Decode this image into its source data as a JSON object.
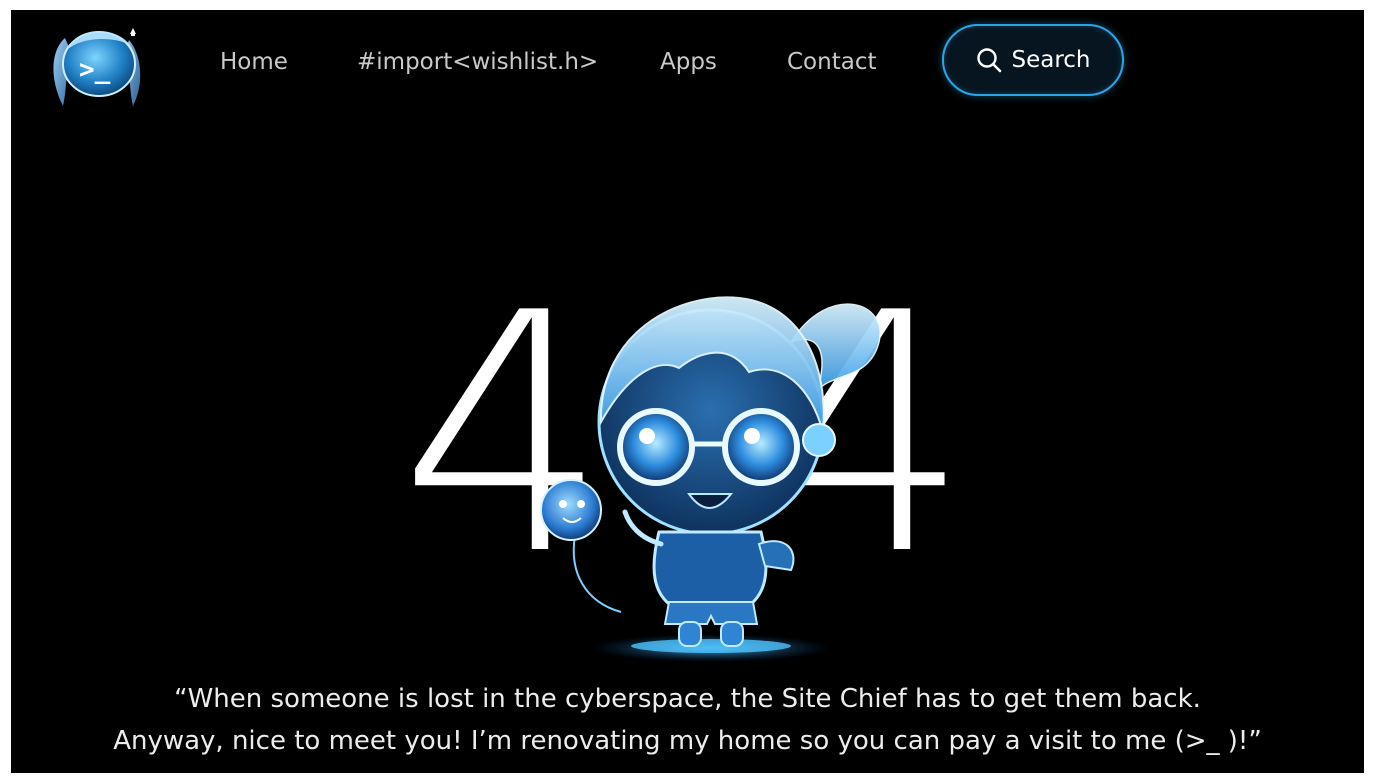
{
  "nav": {
    "logo_alt": "site logo",
    "links": [
      {
        "label": "Home"
      },
      {
        "label": "#import<wishlist.h>"
      },
      {
        "label": "Apps"
      },
      {
        "label": "Contact"
      }
    ],
    "search_label": "Search"
  },
  "hero": {
    "digit_left": "4",
    "digit_right": "4",
    "quote_line1": "“When someone is lost in the cyberspace, the Site Chief has to get them back.",
    "quote_line2": "Anyway, nice to meet you! I’m renovating my home so you can pay a visit to me (>_ )!”"
  },
  "colors": {
    "background": "#000000",
    "accent": "#2aa6e6",
    "nav_text": "#c9c9c9",
    "text": "#ffffff"
  },
  "icons": [
    "logo-icon",
    "search-icon",
    "mascot-illustration"
  ]
}
